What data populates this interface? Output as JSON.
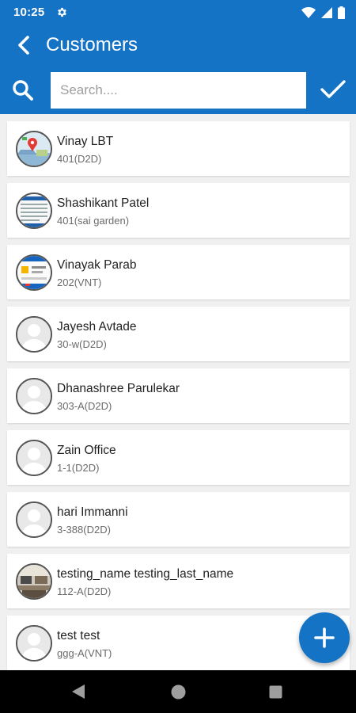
{
  "status": {
    "time": "10:25"
  },
  "header": {
    "title": "Customers"
  },
  "search": {
    "placeholder": "Search...."
  },
  "customers": [
    {
      "name": "Vinay LBT",
      "code": "401(D2D)",
      "avatar": "photo-map"
    },
    {
      "name": "Shashikant Patel",
      "code": "401(sai garden)",
      "avatar": "photo-document"
    },
    {
      "name": "Vinayak Parab",
      "code": "202(VNT)",
      "avatar": "photo-web"
    },
    {
      "name": "Jayesh Avtade",
      "code": "30-w(D2D)",
      "avatar": "default-person"
    },
    {
      "name": "Dhanashree Parulekar",
      "code": "303-A(D2D)",
      "avatar": "default-person"
    },
    {
      "name": "Zain Office",
      "code": "1-1(D2D)",
      "avatar": "default-person"
    },
    {
      "name": "hari Immanni",
      "code": "3-388(D2D)",
      "avatar": "default-person"
    },
    {
      "name": "testing_name testing_last_name",
      "code": "112-A(D2D)",
      "avatar": "photo-room"
    },
    {
      "name": "test test",
      "code": "ggg-A(VNT)",
      "avatar": "default-person"
    }
  ],
  "colors": {
    "primary": "#1573c6",
    "background": "#f0f0f0",
    "card": "#ffffff"
  }
}
